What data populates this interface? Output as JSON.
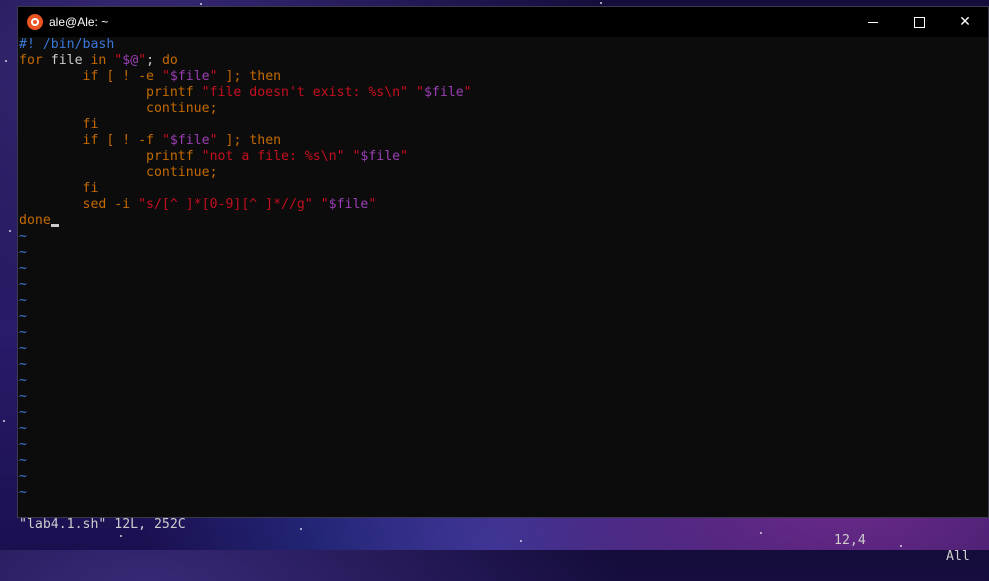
{
  "window": {
    "title": "ale@Ale: ~"
  },
  "editor": {
    "lines": [
      [
        {
          "t": "#! /bin/bash",
          "c": "cmt"
        }
      ],
      [
        {
          "t": "for",
          "c": "kw"
        },
        {
          "t": " file ",
          "c": "norm"
        },
        {
          "t": "in",
          "c": "kw"
        },
        {
          "t": " \"",
          "c": "str"
        },
        {
          "t": "$@",
          "c": "var"
        },
        {
          "t": "\"",
          "c": "str"
        },
        {
          "t": "; ",
          "c": "norm"
        },
        {
          "t": "do",
          "c": "kw"
        }
      ],
      [
        {
          "t": "        ",
          "c": "norm"
        },
        {
          "t": "if",
          "c": "kw"
        },
        {
          "t": " [ ! -e ",
          "c": "kw"
        },
        {
          "t": "\"",
          "c": "str"
        },
        {
          "t": "$file",
          "c": "var"
        },
        {
          "t": "\"",
          "c": "str"
        },
        {
          "t": " ]; ",
          "c": "kw"
        },
        {
          "t": "then",
          "c": "kw"
        }
      ],
      [
        {
          "t": "                ",
          "c": "norm"
        },
        {
          "t": "printf",
          "c": "kw"
        },
        {
          "t": " \"file doesn't exist: %s\\n\" \"",
          "c": "str"
        },
        {
          "t": "$file",
          "c": "var"
        },
        {
          "t": "\"",
          "c": "str"
        }
      ],
      [
        {
          "t": "                ",
          "c": "norm"
        },
        {
          "t": "continue;",
          "c": "kw"
        }
      ],
      [
        {
          "t": "        ",
          "c": "norm"
        },
        {
          "t": "fi",
          "c": "kw"
        }
      ],
      [
        {
          "t": "        ",
          "c": "norm"
        },
        {
          "t": "if",
          "c": "kw"
        },
        {
          "t": " [ ! -f ",
          "c": "kw"
        },
        {
          "t": "\"",
          "c": "str"
        },
        {
          "t": "$file",
          "c": "var"
        },
        {
          "t": "\"",
          "c": "str"
        },
        {
          "t": " ]; ",
          "c": "kw"
        },
        {
          "t": "then",
          "c": "kw"
        }
      ],
      [
        {
          "t": "                ",
          "c": "norm"
        },
        {
          "t": "printf",
          "c": "kw"
        },
        {
          "t": " \"not a file: %s\\n\" \"",
          "c": "str"
        },
        {
          "t": "$file",
          "c": "var"
        },
        {
          "t": "\"",
          "c": "str"
        }
      ],
      [
        {
          "t": "                ",
          "c": "norm"
        },
        {
          "t": "continue;",
          "c": "kw"
        }
      ],
      [
        {
          "t": "        ",
          "c": "norm"
        },
        {
          "t": "fi",
          "c": "kw"
        }
      ],
      [
        {
          "t": "        ",
          "c": "norm"
        },
        {
          "t": "sed -i ",
          "c": "kw"
        },
        {
          "t": "\"s/[^ ]*[0-9][^ ]*//g\" \"",
          "c": "str"
        },
        {
          "t": "$file",
          "c": "var"
        },
        {
          "t": "\"",
          "c": "str"
        }
      ],
      [
        {
          "t": "done",
          "c": "kw"
        }
      ]
    ],
    "empty_line_marker": "~",
    "empty_line_count": 17
  },
  "status": {
    "file_info": "\"lab4.1.sh\" 12L, 252C",
    "cursor_pos": "12,4",
    "scroll": "All"
  },
  "colors": {
    "keyword": "#c46a00",
    "string": "#c50f1f",
    "variable": "#9b3fb5",
    "comment": "#3a78d8",
    "background": "#0c0c0c"
  }
}
